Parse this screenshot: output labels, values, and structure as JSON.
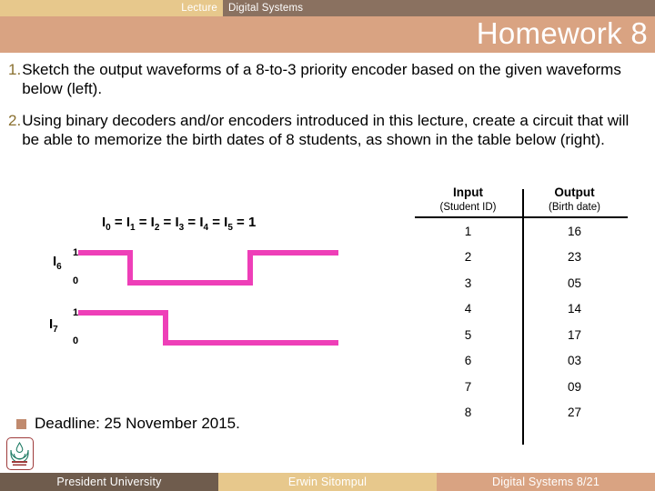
{
  "header": {
    "lecture_label": "Lecture",
    "course_label": "Digital Systems",
    "title": "Homework 8"
  },
  "tasks": [
    {
      "number": "1.",
      "text": "Sketch the output waveforms of a 8-to-3 priority encoder based on the given waveforms below (left)."
    },
    {
      "number": "2.",
      "text": "Using binary decoders and/or encoders introduced in this lecture, create a circuit that will be able to memorize the birth dates of 8 students, as shown in the table below (right)."
    }
  ],
  "waveform": {
    "equation_prefix": "I",
    "equation": "I0 = I1 = I2 = I3 = I4 = I5 = 1",
    "signal_color": "#ee3fb8",
    "signals": [
      {
        "name": "I6",
        "base": "I",
        "sub": "6",
        "high_label": "1",
        "low_label": "0",
        "segments": [
          {
            "level": 1,
            "from": 86,
            "to": 143
          },
          {
            "level": 0,
            "from": 143,
            "to": 275
          },
          {
            "level": 1,
            "from": 275,
            "to": 372
          }
        ]
      },
      {
        "name": "I7",
        "base": "I",
        "sub": "7",
        "high_label": "1",
        "low_label": "0",
        "segments": [
          {
            "level": 1,
            "from": 86,
            "to": 182
          },
          {
            "level": 0,
            "from": 182,
            "to": 372
          }
        ]
      }
    ]
  },
  "table": {
    "columns": [
      {
        "title": "Input",
        "subtitle": "(Student ID)"
      },
      {
        "title": "Output",
        "subtitle": "(Birth date)"
      }
    ],
    "rows": [
      {
        "input": "1",
        "output": "16"
      },
      {
        "input": "2",
        "output": "23"
      },
      {
        "input": "3",
        "output": "05"
      },
      {
        "input": "4",
        "output": "14"
      },
      {
        "input": "5",
        "output": "17"
      },
      {
        "input": "6",
        "output": "03"
      },
      {
        "input": "7",
        "output": "09"
      },
      {
        "input": "8",
        "output": "27"
      }
    ]
  },
  "deadline": {
    "text": "Deadline: 25 November 2015."
  },
  "footer": {
    "left": "President University",
    "center": "Erwin Sitompul",
    "right": "Digital Systems 8/21"
  },
  "colors": {
    "topbar_dark": "#8a7160",
    "gold": "#e7c88c",
    "salmon": "#d9a382",
    "footer_brown": "#6f5c4d",
    "number_gold": "#8a7030",
    "magenta": "#ee3fb8"
  }
}
